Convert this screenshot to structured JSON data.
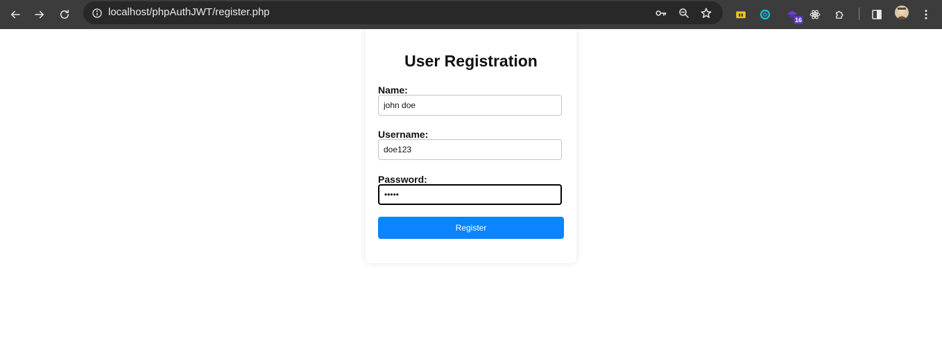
{
  "browser": {
    "url": "localhost/phpAuthJWT/register.php",
    "extension_badge": "16",
    "icons": {
      "back": "arrow-left-icon",
      "forward": "arrow-right-icon",
      "reload": "reload-icon",
      "site_info": "info-icon",
      "password": "key-icon",
      "zoom": "magnifier-icon",
      "bookmark": "star-icon",
      "menu": "kebab-menu-icon"
    }
  },
  "form": {
    "title": "User Registration",
    "name_label": "Name:",
    "name_value": "john doe",
    "username_label": "Username:",
    "username_value": "doe123",
    "password_label": "Password:",
    "password_value": "•••••",
    "submit_label": "Register"
  },
  "colors": {
    "button": "#0a84ff",
    "chrome_bg": "#3c3c3c",
    "omnibox_bg": "#282828"
  }
}
